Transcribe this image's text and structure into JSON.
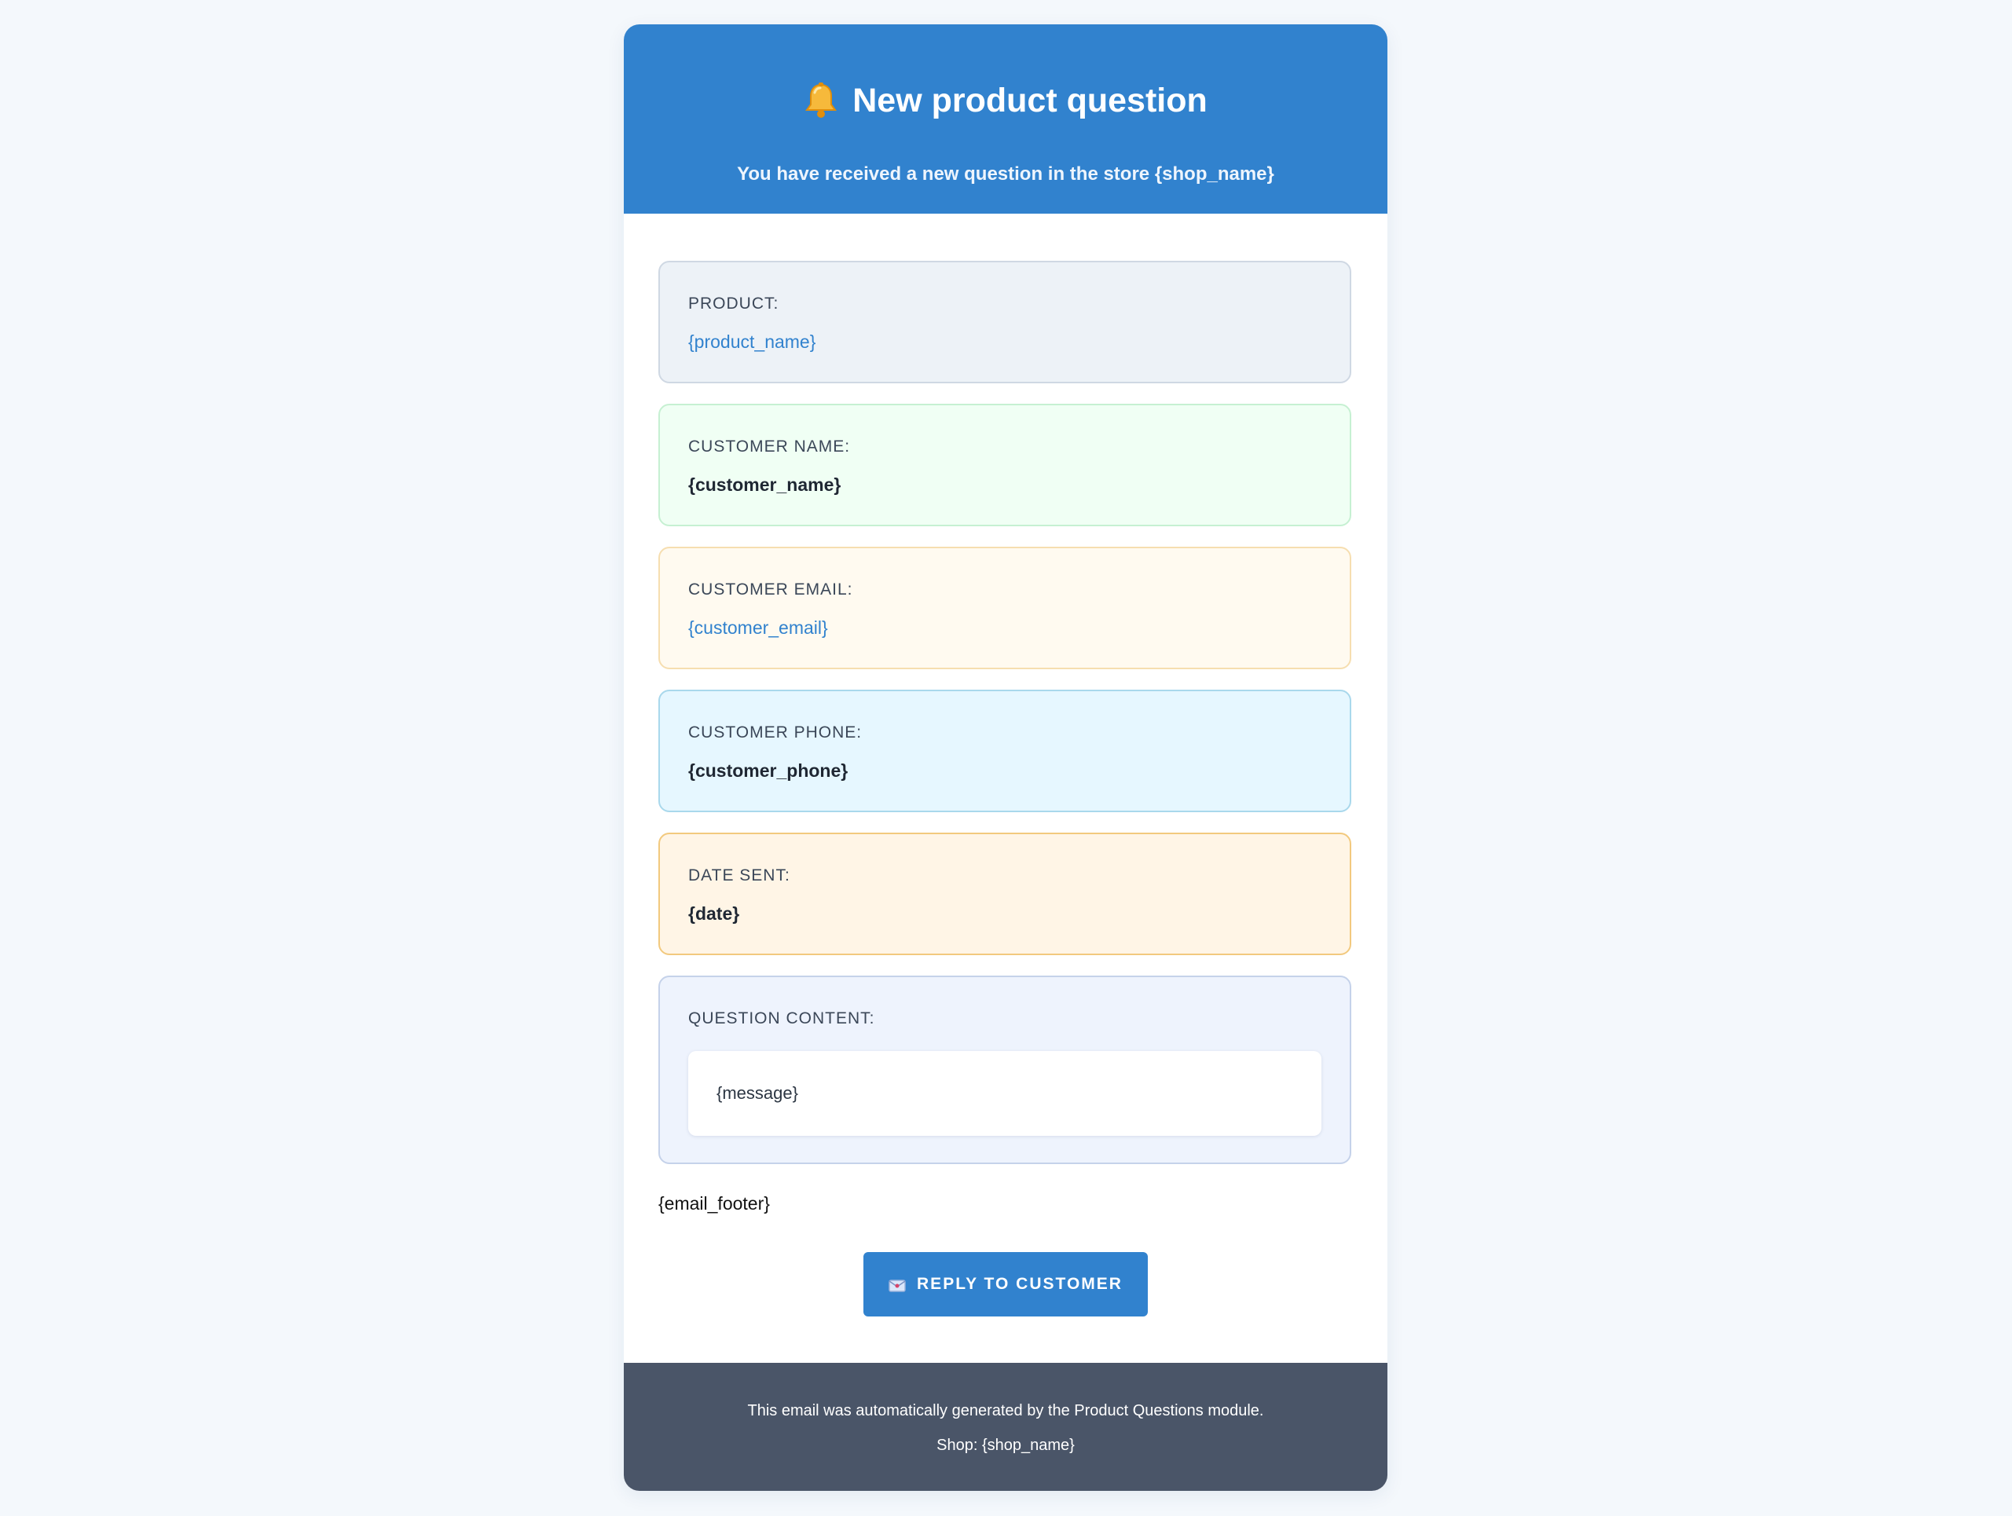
{
  "header": {
    "icon": "bell-icon",
    "title": "New product question",
    "subtitle": "You have received a new question in the store {shop_name}"
  },
  "fields": {
    "product": {
      "label": "PRODUCT:",
      "value": "{product_name}"
    },
    "customer_name": {
      "label": "CUSTOMER NAME:",
      "value": "{customer_name}"
    },
    "customer_email": {
      "label": "CUSTOMER EMAIL:",
      "value": "{customer_email}"
    },
    "customer_phone": {
      "label": "CUSTOMER PHONE:",
      "value": "{customer_phone}"
    },
    "date_sent": {
      "label": "DATE SENT:",
      "value": "{date}"
    },
    "question": {
      "label": "QUESTION CONTENT:",
      "value": "{message}"
    }
  },
  "email_footer": "{email_footer}",
  "reply_button": {
    "icon": "envelope-icon",
    "label": "REPLY TO CUSTOMER"
  },
  "footer": {
    "line1": "This email was automatically generated by the Product Questions module.",
    "line2": "Shop: {shop_name}"
  },
  "colors": {
    "accent": "#3182ce",
    "footer_bg": "#4a5568",
    "page_bg": "#f4f8fc"
  }
}
